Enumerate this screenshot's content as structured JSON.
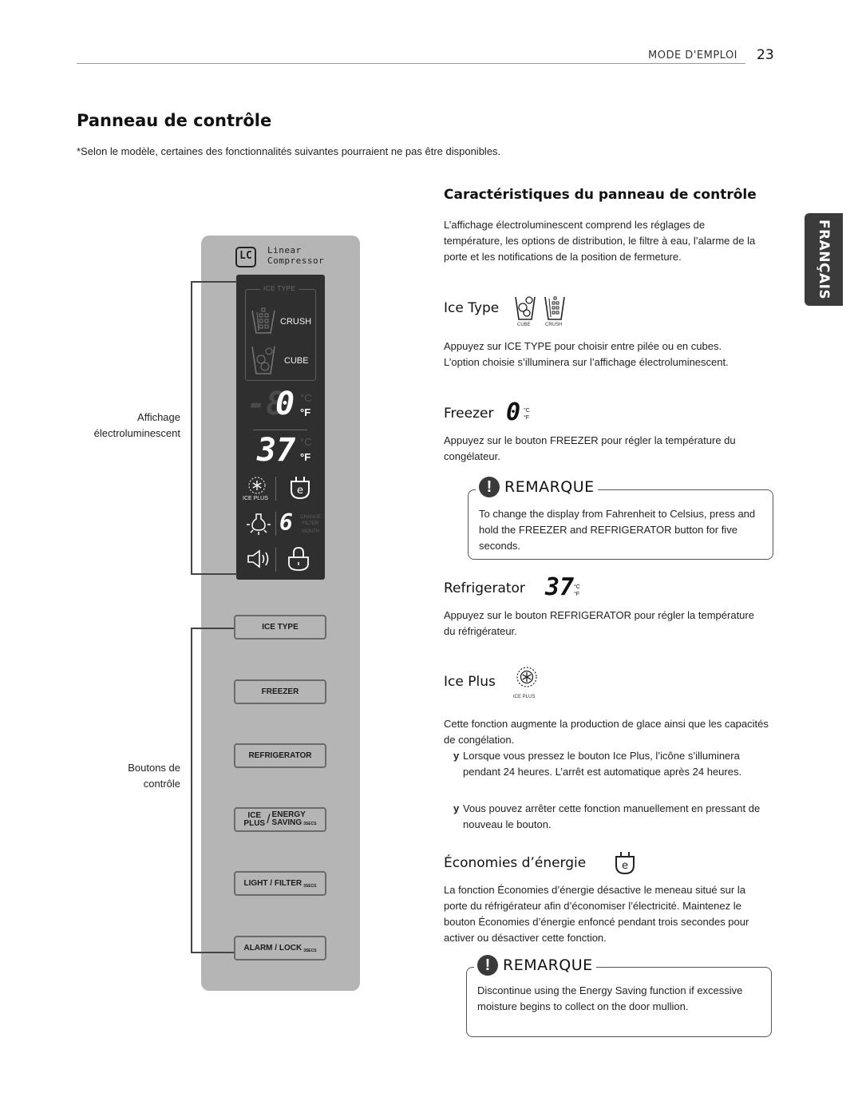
{
  "header": {
    "section": "MODE D'EMPLOI",
    "page_number": "23"
  },
  "page_title": "Panneau de contrôle",
  "subnote": "*Selon le modèle, certaines des fonctionnalités suivantes pourraient ne pas être disponibles.",
  "language_tab": "FRANÇAIS",
  "panel": {
    "logo": {
      "badge": "LC",
      "line1": "Linear",
      "line2": "Compressor"
    },
    "display": {
      "ice_type_label": "ICE TYPE",
      "crush_label": "CRUSH",
      "cube_label": "CUBE",
      "freezer_digits_dim": "-8",
      "freezer_digit_on": "0",
      "fridge_digits": "37",
      "unit_c": "°C",
      "unit_f": "°F",
      "ice_plus_label": "ICE PLUS",
      "filter_digit": "6",
      "change_filter": "CHANGE\nFILTER",
      "month": "MONTH"
    },
    "buttons": [
      {
        "label": "ICE TYPE",
        "suffix": ""
      },
      {
        "label": "FREEZER",
        "suffix": ""
      },
      {
        "label": "REFRIGERATOR",
        "suffix": ""
      },
      {
        "label_top_left": "ICE",
        "label_bottom_left": "PLUS",
        "label_top_right": "ENERGY",
        "label_bottom_right": "SAVING",
        "suffix": "3SECS"
      },
      {
        "label": "LIGHT / FILTER",
        "suffix": "3SECS"
      },
      {
        "label": "ALARM / LOCK",
        "suffix": "3SECS"
      }
    ],
    "labels": {
      "display_line1": "Affichage",
      "display_line2": "électroluminescent",
      "buttons_line1": "Boutons de",
      "buttons_line2": "contrôle"
    }
  },
  "features": {
    "title": "Caractéristiques du panneau de contrôle",
    "intro": "L’affichage électroluminescent comprend les réglages de température, les options de distribution, le filtre à eau, l’alarme de la porte et les notifications de la position de fermeture.",
    "ice_type": {
      "title": "Ice Type",
      "icon_cube_label": "CUBE",
      "icon_crush_label": "CRUSH",
      "text": "Appuyez sur ICE TYPE pour choisir entre pilée ou en cubes. L’option choisie s’illuminera sur l’affichage électroluminescent."
    },
    "freezer": {
      "title": "Freezer",
      "digit": "0",
      "unit_c": "°C",
      "unit_f": "°F",
      "text": "Appuyez sur le bouton FREEZER pour régler la température du congélateur."
    },
    "note1": {
      "title": "REMARQUE",
      "icon": "!",
      "text": "To change the display from Fahrenheit to Celsius, press and hold the FREEZER and REFRIGERATOR button for five seconds."
    },
    "refrigerator": {
      "title": "Refrigerator",
      "digits": "37",
      "unit_c": "°C",
      "unit_f": "°F",
      "text": "Appuyez sur le bouton REFRIGERATOR pour régler la température du réfrigérateur."
    },
    "ice_plus": {
      "title": "Ice Plus",
      "icon_label": "ICE PLUS",
      "text": "Cette fonction augmente la production de glace ainsi que les capacités de congélation.",
      "bullets": [
        "Lorsque vous pressez le bouton Ice Plus, l’icône s’illuminera pendant 24 heures. L’arrêt est automatique après 24 heures.",
        "Vous pouvez arrêter cette fonction manuellement en pressant de nouveau le bouton."
      ],
      "bullet_marker": "y"
    },
    "energy": {
      "title": "Économies d’énergie",
      "text": "La fonction Économies d’énergie désactive le meneau situé sur la porte du réfrigérateur afin d’économiser l’électricité. Maintenez le bouton Économies d’énergie enfoncé pendant trois secondes pour activer ou désactiver cette fonction."
    },
    "note2": {
      "title": "REMARQUE",
      "icon": "!",
      "text": "Discontinue using the Energy Saving function if excessive moisture begins to collect on the door mullion."
    }
  }
}
